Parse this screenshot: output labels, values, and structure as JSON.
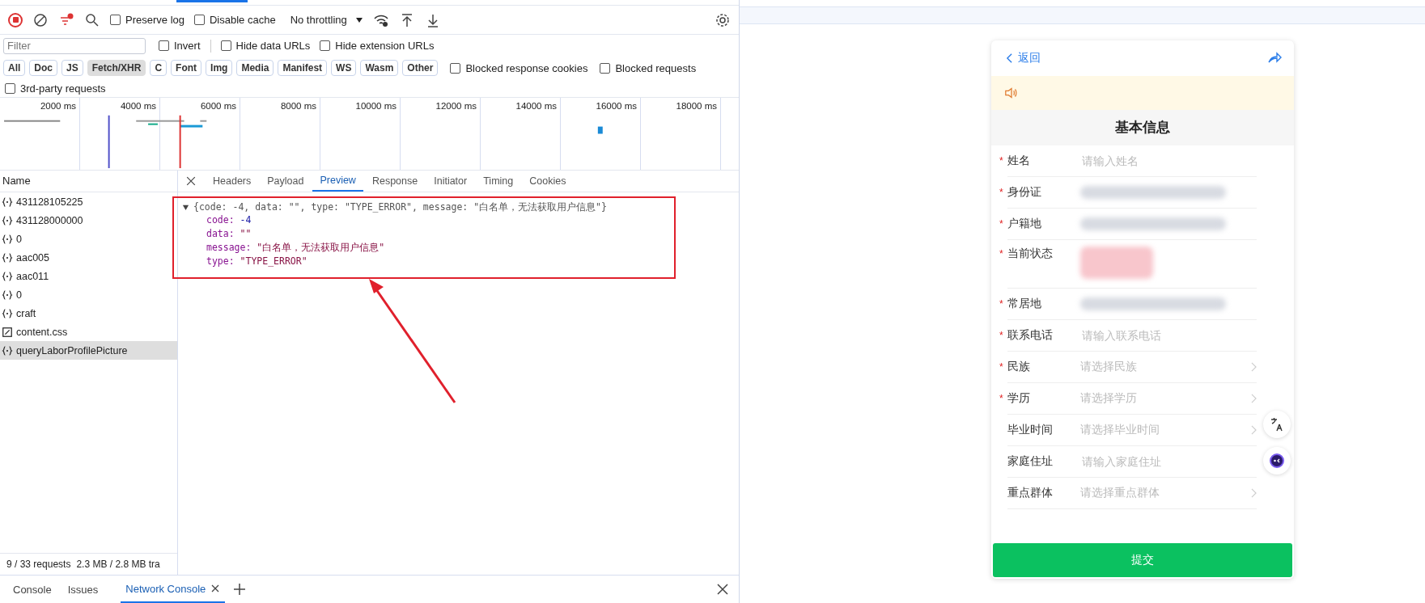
{
  "devtools": {
    "toolbar": {
      "recording": true,
      "preserve_log": {
        "label": "Preserve log",
        "checked": false
      },
      "disable_cache": {
        "label": "Disable cache",
        "checked": false
      },
      "throttling": "No throttling"
    },
    "filter": {
      "placeholder": "Filter",
      "options": [
        {
          "label": "Invert",
          "checked": false
        },
        {
          "label": "Hide data URLs",
          "checked": false
        },
        {
          "label": "Hide extension URLs",
          "checked": false
        }
      ]
    },
    "type_filters": [
      {
        "label": "All",
        "selected": false
      },
      {
        "label": "Doc",
        "selected": false
      },
      {
        "label": "JS",
        "selected": false
      },
      {
        "label": "Fetch/XHR",
        "selected": true
      },
      {
        "label": "C",
        "selected": false
      },
      {
        "label": "Font",
        "selected": false
      },
      {
        "label": "Img",
        "selected": false
      },
      {
        "label": "Media",
        "selected": false
      },
      {
        "label": "Manifest",
        "selected": false
      },
      {
        "label": "WS",
        "selected": false
      },
      {
        "label": "Wasm",
        "selected": false
      },
      {
        "label": "Other",
        "selected": false
      }
    ],
    "extra_filters": [
      {
        "label": "Blocked response cookies",
        "checked": false
      },
      {
        "label": "Blocked requests",
        "checked": false
      },
      {
        "label": "3rd-party requests",
        "checked": false
      }
    ],
    "timeline_ticks": [
      "2000 ms",
      "4000 ms",
      "6000 ms",
      "8000 ms",
      "10000 ms",
      "12000 ms",
      "14000 ms",
      "16000 ms",
      "18000 ms"
    ],
    "name_header": "Name",
    "requests": [
      {
        "name": "431128105225",
        "kind": "fetch",
        "selected": false
      },
      {
        "name": "431128000000",
        "kind": "fetch",
        "selected": false
      },
      {
        "name": "0",
        "kind": "fetch",
        "selected": false
      },
      {
        "name": "aac005",
        "kind": "fetch",
        "selected": false
      },
      {
        "name": "aac011",
        "kind": "fetch",
        "selected": false
      },
      {
        "name": "0",
        "kind": "fetch",
        "selected": false
      },
      {
        "name": "craft",
        "kind": "fetch",
        "selected": false
      },
      {
        "name": "content.css",
        "kind": "stylesheet",
        "selected": false
      },
      {
        "name": "queryLaborProfilePicture",
        "kind": "fetch",
        "selected": true
      }
    ],
    "detail_tabs": [
      {
        "label": "Headers",
        "selected": false
      },
      {
        "label": "Payload",
        "selected": false
      },
      {
        "label": "Preview",
        "selected": true
      },
      {
        "label": "Response",
        "selected": false
      },
      {
        "label": "Initiator",
        "selected": false
      },
      {
        "label": "Timing",
        "selected": false
      },
      {
        "label": "Cookies",
        "selected": false
      }
    ],
    "preview": {
      "expanded": true,
      "summary": "{code: -4, data: \"\", type: \"TYPE_ERROR\", message: \"白名单，无法获取用户信息\"}",
      "properties": [
        {
          "key": "code:",
          "value": "-4",
          "kind": "number"
        },
        {
          "key": "data:",
          "value": "\"\"",
          "kind": "string"
        },
        {
          "key": "message:",
          "value": "\"白名单，无法获取用户信息\"",
          "kind": "string"
        },
        {
          "key": "type:",
          "value": "\"TYPE_ERROR\"",
          "kind": "string"
        }
      ]
    },
    "status_bar": {
      "requests": "9 / 33 requests",
      "transferred": "2.3 MB / 2.8 MB tra"
    },
    "drawer_tabs": [
      {
        "label": "Console",
        "selected": false,
        "closable": false
      },
      {
        "label": "Issues",
        "selected": false,
        "closable": false
      },
      {
        "label": "Network Console",
        "selected": true,
        "closable": true
      }
    ]
  },
  "phone": {
    "required_mark": "*",
    "back": "返回",
    "title": "基本信息",
    "submit": "提交",
    "fields": [
      {
        "label": "姓名",
        "required": true,
        "kind": "input",
        "placeholder": "请输入姓名"
      },
      {
        "label": "身份证",
        "required": true,
        "kind": "redacted"
      },
      {
        "label": "户籍地",
        "required": true,
        "kind": "redacted"
      },
      {
        "label": "当前状态",
        "required": true,
        "kind": "redacted_tall"
      },
      {
        "label": "常居地",
        "required": true,
        "kind": "redacted"
      },
      {
        "label": "联系电话",
        "required": true,
        "kind": "input",
        "placeholder": "请输入联系电话"
      },
      {
        "label": "民族",
        "required": true,
        "kind": "select",
        "placeholder": "请选择民族"
      },
      {
        "label": "学历",
        "required": true,
        "kind": "select",
        "placeholder": "请选择学历"
      },
      {
        "label": "毕业时间",
        "required": false,
        "kind": "select",
        "placeholder": "请选择毕业时间"
      },
      {
        "label": "家庭住址",
        "required": false,
        "kind": "input",
        "placeholder": "请输入家庭住址"
      },
      {
        "label": "重点群体",
        "required": false,
        "kind": "select",
        "placeholder": "请选择重点群体"
      }
    ]
  }
}
